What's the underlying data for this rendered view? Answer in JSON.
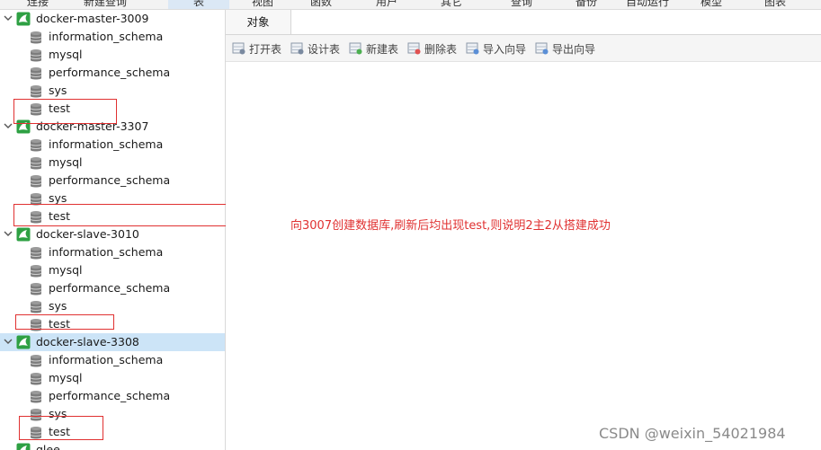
{
  "toolbar": {
    "items": [
      {
        "label": "连接",
        "active": false
      },
      {
        "label": "新建查询",
        "active": false
      },
      {
        "label": "表",
        "active": true
      },
      {
        "label": "视图",
        "active": false
      },
      {
        "label": "函数",
        "active": false
      },
      {
        "label": "用户",
        "active": false
      },
      {
        "label": "其它",
        "active": false
      },
      {
        "label": "查询",
        "active": false
      },
      {
        "label": "备份",
        "active": false
      },
      {
        "label": "自动运行",
        "active": false
      },
      {
        "label": "模型",
        "active": false
      },
      {
        "label": "图表",
        "active": false
      }
    ]
  },
  "sidebar": {
    "connections": [
      {
        "name": "docker-master-3009",
        "selected": false,
        "databases": [
          "information_schema",
          "mysql",
          "performance_schema",
          "sys",
          "test"
        ]
      },
      {
        "name": "docker-master-3307",
        "selected": false,
        "databases": [
          "information_schema",
          "mysql",
          "performance_schema",
          "sys",
          "test"
        ]
      },
      {
        "name": "docker-slave-3010",
        "selected": false,
        "databases": [
          "information_schema",
          "mysql",
          "performance_schema",
          "sys",
          "test"
        ]
      },
      {
        "name": "docker-slave-3308",
        "selected": true,
        "databases": [
          "information_schema",
          "mysql",
          "performance_schema",
          "sys",
          "test"
        ]
      },
      {
        "name": "glee",
        "selected": false,
        "databases": []
      }
    ]
  },
  "tabs": {
    "objects_label": "对象"
  },
  "object_toolbar": {
    "buttons": [
      {
        "label": "打开表",
        "icon": "open-table-icon"
      },
      {
        "label": "设计表",
        "icon": "design-table-icon"
      },
      {
        "label": "新建表",
        "icon": "new-table-icon"
      },
      {
        "label": "删除表",
        "icon": "delete-table-icon"
      },
      {
        "label": "导入向导",
        "icon": "import-wizard-icon"
      },
      {
        "label": "导出向导",
        "icon": "export-wizard-icon"
      }
    ]
  },
  "annotation": {
    "text": "向3007创建数据库,刷新后均出现test,则说明2主2从搭建成功",
    "color": "#e03131"
  },
  "watermark": {
    "text": "CSDN @weixin_54021984"
  },
  "colors": {
    "selection": "#cce4f7",
    "annotation_red": "#e03131",
    "connection_icon_green": "#2ea043"
  }
}
